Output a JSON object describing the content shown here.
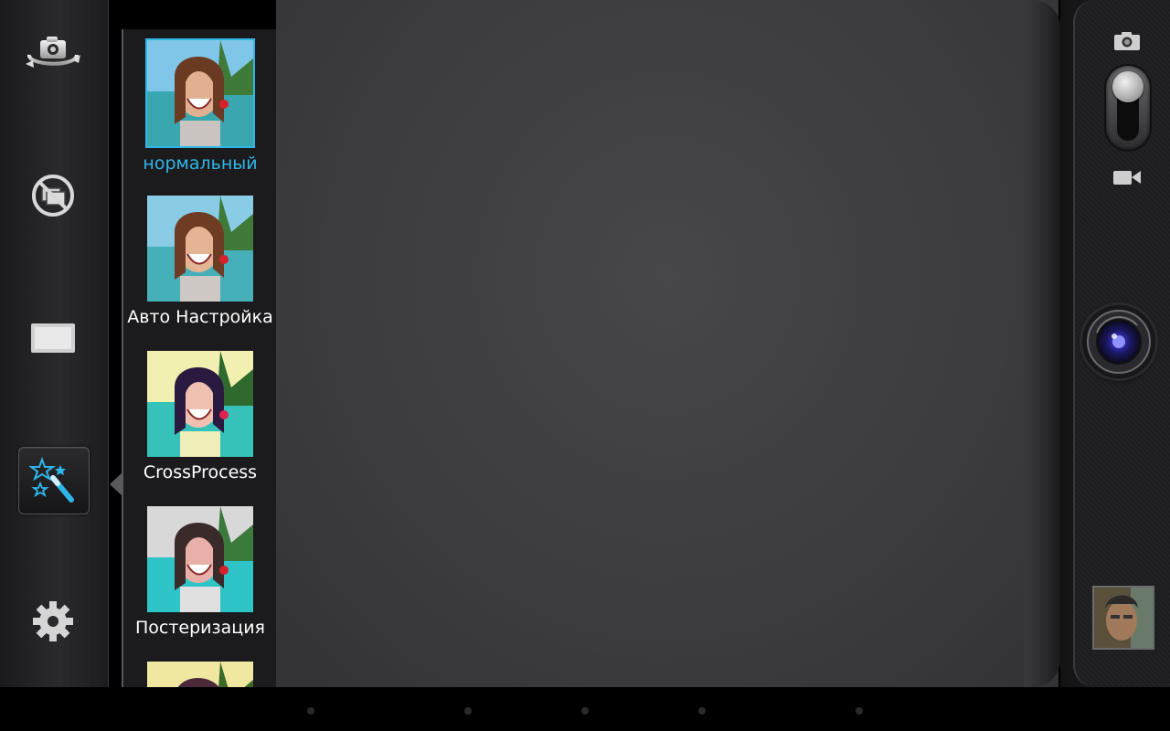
{
  "left_toolbar": {
    "buttons": [
      {
        "name": "switch-camera-button",
        "icon": "camera-rotate-icon"
      },
      {
        "name": "panorama-mode-button",
        "icon": "no-overlay-icon"
      },
      {
        "name": "aspect-ratio-button",
        "icon": "widescreen-icon"
      },
      {
        "name": "effects-button",
        "icon": "magic-wand-icon",
        "active": true
      },
      {
        "name": "settings-button",
        "icon": "gear-icon"
      }
    ]
  },
  "filter_panel": {
    "items": [
      {
        "label": "нормальный",
        "selected": true,
        "style": "normal"
      },
      {
        "label": "Авто Настройка",
        "selected": false,
        "style": "auto"
      },
      {
        "label": "CrossProcess",
        "selected": false,
        "style": "cross"
      },
      {
        "label": "Постеризация",
        "selected": false,
        "style": "poster"
      },
      {
        "label": "",
        "selected": false,
        "style": "next"
      }
    ]
  },
  "right_bar": {
    "photo_icon": "camera-icon",
    "video_icon": "video-camera-icon",
    "mode_switch": "photo",
    "shutter_icon": "lens-icon",
    "last_photo_icon": "thumbnail-preview"
  },
  "colors": {
    "accent": "#2fb6e8",
    "panel_bg": "#1b1b1d",
    "viewfinder_bg": "#3c3c3e"
  }
}
